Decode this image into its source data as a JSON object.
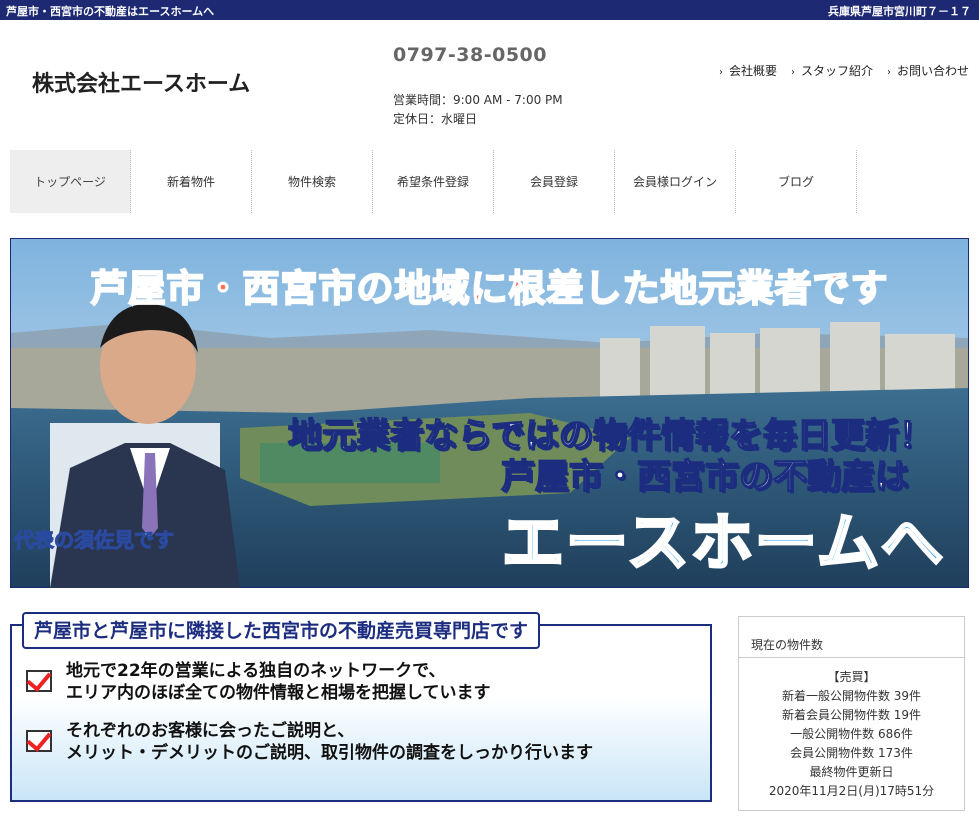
{
  "topbar": {
    "left": "芦屋市・西宮市の不動産はエースホームへ",
    "right": "兵庫県芦屋市宮川町７－１７"
  },
  "header": {
    "company": "株式会社エースホーム",
    "phone": "0797-38-0500",
    "hours": "営業時間：9:00 AM - 7:00 PM",
    "closed": "定休日：水曜日",
    "links": [
      "会社概要",
      "スタッフ紹介",
      "お問い合わせ"
    ]
  },
  "nav": [
    "トップページ",
    "新着物件",
    "物件検索",
    "希望条件登録",
    "会員登録",
    "会員様ログイン",
    "ブログ"
  ],
  "banner": {
    "headline": "芦屋市・西宮市の地域に根差した地元業者です",
    "tag1": "地元業者ならではの物件情報を毎日更新！",
    "tag2": "芦屋市・西宮市の不動産は",
    "tag3": "エースホームへ",
    "rep": "代表の須佐見です"
  },
  "info": {
    "title": "芦屋市と芦屋市に隣接した西宮市の不動産売買専門店です",
    "points": [
      {
        "l1": "地元で22年の営業による独自のネットワークで、",
        "l2": "エリア内のほぼ全ての物件情報と相場を把握しています"
      },
      {
        "l1": "それぞれのお客様に会ったご説明と、",
        "l2": "メリット・デメリットのご説明、取引物件の調査をしっかり行います"
      }
    ]
  },
  "sidebox": {
    "title": "現在の物件数",
    "lines": [
      "【売買】",
      "新着一般公開物件数 39件",
      "新着会員公開物件数 19件",
      "一般公開物件数 686件",
      "会員公開物件数 173件",
      "最終物件更新日",
      "2020年11月2日(月)17時51分"
    ]
  },
  "colors": {
    "navy": "#1d2a73",
    "headline": "#ff6f53",
    "brand_blue": "#1e9de8"
  }
}
